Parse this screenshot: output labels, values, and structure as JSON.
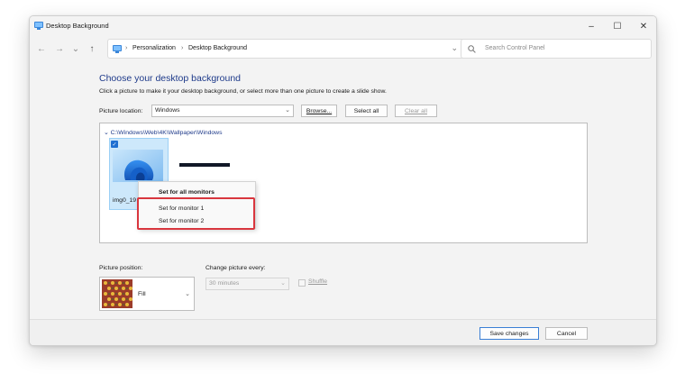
{
  "window": {
    "title": "Desktop Background",
    "controls": {
      "minimize": "–",
      "maximize": "☐",
      "close": "✕"
    }
  },
  "nav": {
    "back": "←",
    "forward": "→",
    "recent": "⌄",
    "up": "↑",
    "breadcrumb": [
      "Personalization",
      "Desktop Background"
    ],
    "separator": "›",
    "dropdown": "⌄",
    "refresh": "↻",
    "search_placeholder": "Search Control Panel"
  },
  "main": {
    "heading": "Choose your desktop background",
    "subheading": "Click a picture to make it your desktop background, or select more than one picture to create a slide show.",
    "picture_location": {
      "label": "Picture location:",
      "value": "Windows"
    },
    "buttons": {
      "browse": "Browse...",
      "select_all": "Select all",
      "clear_all": "Clear all"
    },
    "folder_path": "C:\\Windows\\Web\\4K\\Wallpaper\\Windows",
    "thumbnail_label": "img0_19"
  },
  "context_menu": {
    "items": [
      "Set for all monitors",
      "Set for monitor 1",
      "Set for monitor 2"
    ]
  },
  "options": {
    "picture_position": {
      "label": "Picture position:",
      "value": "Fill"
    },
    "change_every": {
      "label": "Change picture every:",
      "value": "30 minutes"
    },
    "shuffle": {
      "label": "Shuffle",
      "checked": false
    }
  },
  "footer": {
    "save": "Save changes",
    "cancel": "Cancel"
  },
  "colors": {
    "accent": "#1f6fd1",
    "heading": "#1e3a8a",
    "highlight_border": "#d9363e",
    "disabled_text": "#9a9a9a"
  }
}
